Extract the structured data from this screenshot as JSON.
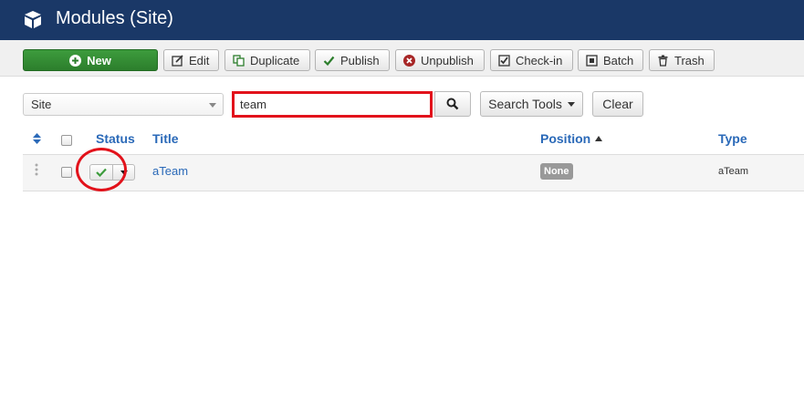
{
  "header": {
    "title": "Modules (Site)",
    "logo_icon": "cube-icon",
    "background": "#1a3867"
  },
  "toolbar": {
    "new_label": "New",
    "edit_label": "Edit",
    "duplicate_label": "Duplicate",
    "publish_label": "Publish",
    "unpublish_label": "Unpublish",
    "checkin_label": "Check-in",
    "batch_label": "Batch",
    "trash_label": "Trash"
  },
  "filter": {
    "client_select": "Site",
    "search_value": "team",
    "search_tools_label": "Search Tools",
    "clear_label": "Clear"
  },
  "table": {
    "columns": {
      "status": "Status",
      "title": "Title",
      "position": "Position",
      "type": "Type"
    },
    "rows": [
      {
        "title": "aTeam",
        "position": "None",
        "type": "aTeam",
        "published": true
      }
    ]
  },
  "colors": {
    "accent": "#2a69b8",
    "highlight": "#e2121b",
    "new_button": "#3d9c3d",
    "publish_check": "#3d9c3d"
  }
}
